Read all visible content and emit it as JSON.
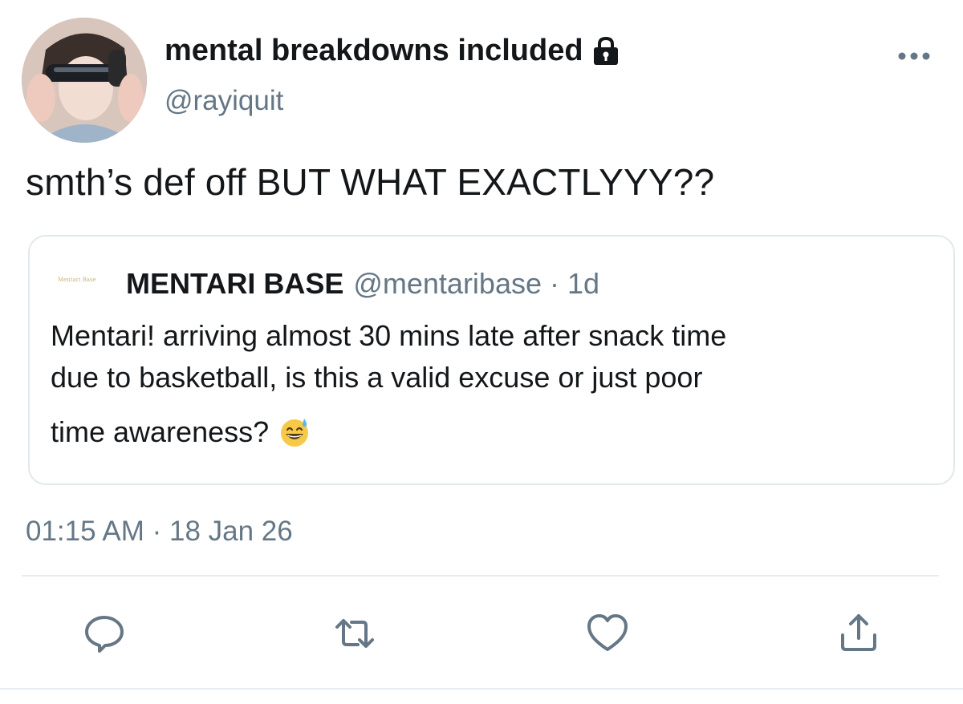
{
  "author": {
    "display_name": "mental breakdowns included",
    "handle": "@rayiquit",
    "protected": true
  },
  "tweet": {
    "text": "smth’s def off BUT WHAT EXACTLYYY??",
    "timestamp": "01:15 AM · 18 Jan 26"
  },
  "quoted_tweet": {
    "avatar_text": "Mentari Base",
    "display_name": "MENTARI BASE",
    "meta": "@mentaribase · 1d",
    "lines": [
      "Mentari! arriving almost 30 mins late after snack time",
      "due to basketball, is this a valid excuse or just poor",
      "time awareness?"
    ],
    "emoji": "grinning-face-with-sweat"
  },
  "actions": [
    "reply-icon",
    "retweet-icon",
    "like-icon",
    "share-icon"
  ],
  "colors": {
    "text_primary": "#14171a",
    "text_secondary": "#657786",
    "border": "#e1e8ed"
  }
}
